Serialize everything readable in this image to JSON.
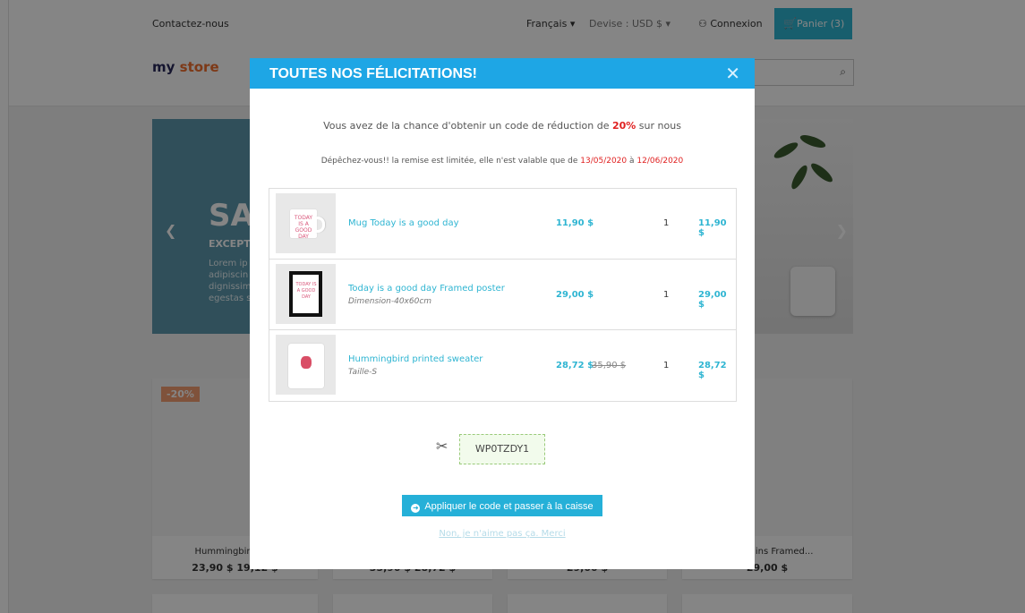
{
  "store": {
    "contact_label": "Contactez-nous",
    "language_label": "Français ▾",
    "currency_label": "Devise : USD $ ▾",
    "login_label": "Connexion",
    "cart_label": "Panier (3)",
    "logo_text_my": "my",
    "logo_text_store": "store",
    "slider_title": "SA",
    "slider_sub": "EXCEPT",
    "slider_lorem": "Lorem ip adipiscin dignissim egestas s",
    "discount_badge": "-20%",
    "cards": [
      {
        "title": "Hummingbird Pr...",
        "price": "23,90 $ 19,12 $"
      },
      {
        "title": "",
        "price": "35,90 $ 28,72 $"
      },
      {
        "title": "",
        "price": "29,00 $"
      },
      {
        "title": "...e Begins Framed...",
        "price": "29,00 $"
      }
    ]
  },
  "modal": {
    "title": "TOUTES NOS FÉLICITATIONS!",
    "close_glyph": "✕",
    "intro_before": "Vous avez de la chance d'obtenir un code de réduction de ",
    "intro_percent": "20%",
    "intro_after": " sur nous",
    "hurry_text": "Dépêchez-vous!! la remise est limitée, elle n'est valable que de ",
    "date_from": "13/05/2020",
    "date_sep": " à ",
    "date_to": "12/06/2020",
    "products": [
      {
        "name": "Mug Today is a good day",
        "attr": "",
        "unit_price": "11,90 $",
        "old_price": "",
        "qty": "1",
        "total": "11,90 $",
        "thumb_text": "TODAY IS A GOOD DAY"
      },
      {
        "name": "Today is a good day Framed poster",
        "attr": "Dimension-40x60cm",
        "unit_price": "29,00 $",
        "old_price": "",
        "qty": "1",
        "total": "29,00 $",
        "thumb_text": "TODAY IS A GOOD DAY"
      },
      {
        "name": "Hummingbird printed sweater",
        "attr": "Taille-S",
        "unit_price": "28,72 $",
        "old_price": "35,90 $",
        "qty": "1",
        "total": "28,72 $",
        "thumb_text": ""
      }
    ],
    "coupon_code": "WP0TZDY1",
    "apply_label": "Appliquer le code et passer à la caisse",
    "decline_label": "Non, je n'aime pas ça. Merci"
  },
  "colors": {
    "accent": "#1ea6e5",
    "button": "#25b0d8",
    "link": "#2fb5d2",
    "highlight": "#e02020"
  }
}
